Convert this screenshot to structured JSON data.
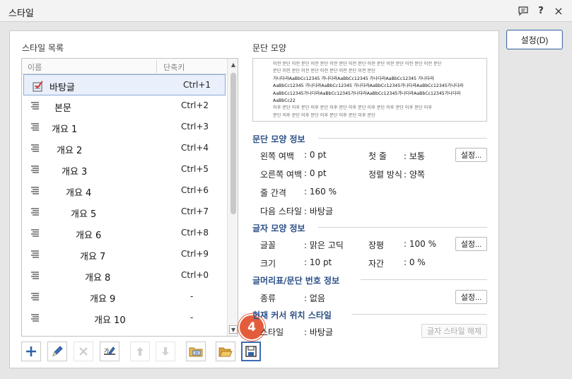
{
  "window": {
    "title": "스타일",
    "icons": [
      "comment-icon",
      "help-icon",
      "close-icon"
    ],
    "help_label": "?",
    "close_label": "×"
  },
  "side": {
    "settings_button": "설정(D)"
  },
  "style_list": {
    "heading": "스타일 목록",
    "col_name": "이름",
    "col_key": "단축키",
    "rows": [
      {
        "name": "바탕글",
        "key": "Ctrl+1"
      },
      {
        "name": "본문",
        "key": "Ctrl+2"
      },
      {
        "name": "개요 1",
        "key": "Ctrl+3"
      },
      {
        "name": "개요 2",
        "key": "Ctrl+4"
      },
      {
        "name": "개요 3",
        "key": "Ctrl+5"
      },
      {
        "name": "개요 4",
        "key": "Ctrl+6"
      },
      {
        "name": "개요 5",
        "key": "Ctrl+7"
      },
      {
        "name": "개요 6",
        "key": "Ctrl+8"
      },
      {
        "name": "개요 7",
        "key": "Ctrl+9"
      },
      {
        "name": "개요 8",
        "key": "Ctrl+0"
      },
      {
        "name": "개요 9",
        "key": "-"
      },
      {
        "name": "개요 10",
        "key": "-"
      }
    ],
    "selected_index": 0
  },
  "preview": {
    "heading": "문단 모양",
    "lines": [
      "이전 문단 이전 문단 이전 문단 이전 문단 이전 문단 이전 문단 이전 문단 이전 문단 이전 문단",
      "문단 이전 문단 이전 문단 이전 문단 이전 문단 이전 문단",
      "가나다라AaBbCc12345      가나다라AaBbCc12345      가나다라AaBbCc12345      가나다라",
      "AaBbCc12345  가나다라AaBbCc12345  가나다라AaBbCc12345가나다라AaBbCc12345가나다라",
      "AaBbCc12345가나다라AaBbCc12345가나다라AaBbCc12345가나다라AaBbCc12345가나다라",
      "AaBbCc22",
      "이후 문단 이후 문단 이후 문단 이후 문단 이후 문단 이후 문단 이후 문단 이후 문단 이후",
      "문단 이후 문단 이후 문단 이후 문단 이후 문단 이후 문단"
    ]
  },
  "para_info": {
    "title": "문단 모양 정보",
    "left_margin_label": "왼쪽 여백",
    "left_margin_value": ": 0 pt",
    "first_line_label": "첫 줄",
    "first_line_value": ": 보통",
    "right_margin_label": "오른쪽 여백",
    "right_margin_value": ": 0 pt",
    "align_label": "정렬 방식",
    "align_value": ": 양쪽",
    "line_spacing_label": "줄 간격",
    "line_spacing_value": ": 160 %",
    "next_style_label": "다음 스타일",
    "next_style_value": ": 바탕글",
    "settings_button": "설정..."
  },
  "char_info": {
    "title": "글자 모양 정보",
    "font_label": "글꼴",
    "font_value": ": 맑은 고딕",
    "width_label": "장평",
    "width_value": ": 100 %",
    "size_label": "크기",
    "size_value": ": 10 pt",
    "spacing_label": "자간",
    "spacing_value": ": 0 %",
    "settings_button": "설정..."
  },
  "bullet_info": {
    "title": "글머리표/문단 번호 정보",
    "type_label": "종류",
    "type_value": ": 없음",
    "settings_button": "설정..."
  },
  "cursor_info": {
    "title": "현재 커서 위치 스타일",
    "style_label": "스타일",
    "style_value": ": 바탕글",
    "clear_button": "글자 스타일 해제"
  },
  "toolbar": {
    "tools": [
      "add-style",
      "edit-style",
      "delete-style",
      "replace-style",
      "move-up",
      "move-down",
      "import-styles",
      "open-styles",
      "save-styles"
    ]
  },
  "badge": {
    "number": "4"
  },
  "colors": {
    "accent": "#3d6cb0",
    "badge": "#e35d3c",
    "section_title": "#2b4f86"
  }
}
